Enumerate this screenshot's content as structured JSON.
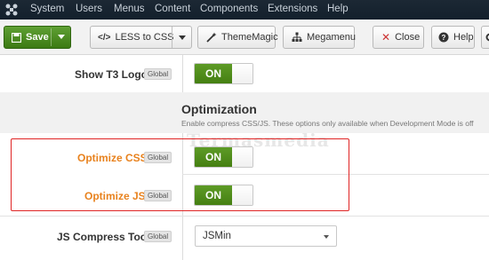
{
  "menubar": {
    "items": [
      "System",
      "Users",
      "Menus",
      "Content",
      "Components",
      "Extensions",
      "Help"
    ]
  },
  "toolbar": {
    "save_label": "Save",
    "less_label": "LESS to CSS",
    "thememagic_label": "ThemeMagic",
    "megamenu_label": "Megamenu",
    "close_label": "Close",
    "help_label": "Help"
  },
  "fields": {
    "show_logo": {
      "label": "Show T3 Logo",
      "badge": "Global",
      "value": "ON"
    },
    "optimize_css": {
      "label": "Optimize CSS",
      "badge": "Global",
      "value": "ON"
    },
    "optimize_js": {
      "label": "Optimize JS",
      "badge": "Global",
      "value": "ON"
    },
    "js_compress": {
      "label": "JS Compress Tool",
      "badge": "Global",
      "value": "JSMin"
    }
  },
  "section": {
    "title": "Optimization",
    "description": "Enable compress CSS/JS. These options only available when Development Mode is off"
  },
  "watermark": "Termasmedia",
  "colors": {
    "menubar_bg": "#1c2834",
    "save_green": "#4a8a1f",
    "toggle_green": "#5d9b26",
    "highlight_label": "#e8821e",
    "highlight_box": "#e02424"
  }
}
